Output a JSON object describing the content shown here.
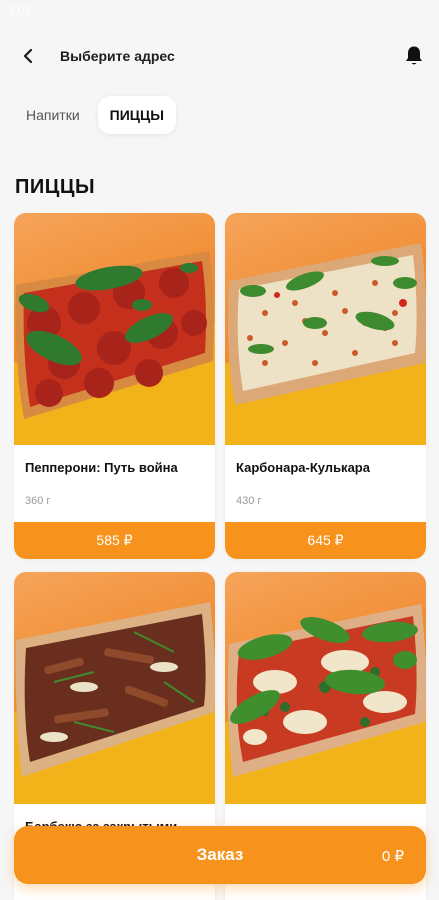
{
  "status": {
    "time": "9:07"
  },
  "header": {
    "title": "Выберите адрес"
  },
  "tabs": [
    {
      "label": "Напитки",
      "active": false
    },
    {
      "label": "ПИЦЦЫ",
      "active": true
    }
  ],
  "section": {
    "title": "ПИЦЦЫ"
  },
  "products": [
    {
      "name": "Пепперони: Путь война",
      "weight": "360 г",
      "price": "585 ₽",
      "image": "pepperoni-pizza"
    },
    {
      "name": "Карбонара-Кулькара",
      "weight": "430 г",
      "price": "645 ₽",
      "image": "carbonara-pizza"
    },
    {
      "name": "Барбекю за закрытыми",
      "weight": "",
      "price": "",
      "image": "bbq-pizza"
    },
    {
      "name": "",
      "weight": "",
      "price": "",
      "image": "margherita-pizza"
    }
  ],
  "order": {
    "label": "Заказ",
    "total": "0 ₽"
  },
  "colors": {
    "accent": "#f7931d",
    "background": "#f6f6f6"
  }
}
